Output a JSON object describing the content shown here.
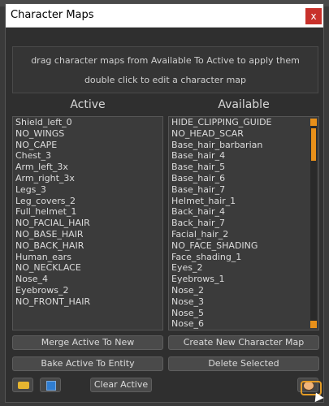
{
  "window": {
    "title": "Character Maps",
    "close_label": "x"
  },
  "info": {
    "line1": "drag character maps from Available To Active to apply them",
    "line2": "double click to edit a character map"
  },
  "active": {
    "header": "Active",
    "items": [
      "Shield_left_0",
      "NO_WINGS",
      "NO_CAPE",
      "Chest_3",
      "Arm_left_3x",
      "Arm_right_3x",
      "Legs_3",
      "Leg_covers_2",
      "Full_helmet_1",
      "NO_FACIAL_HAIR",
      "NO_BASE_HAIR",
      "NO_BACK_HAIR",
      "Human_ears",
      "NO_NECKLACE",
      "Nose_4",
      "Eyebrows_2",
      "NO_FRONT_HAIR"
    ]
  },
  "available": {
    "header": "Available",
    "items": [
      "HIDE_CLIPPING_GUIDE",
      "NO_HEAD_SCAR",
      "Base_hair_barbarian",
      "Base_hair_4",
      "Base_hair_5",
      "Base_hair_6",
      "Base_hair_7",
      "Helmet_hair_1",
      "Back_hair_4",
      "Back_hair_7",
      "Facial_hair_2",
      "NO_FACE_SHADING",
      "Face_shading_1",
      "Eyes_2",
      "Eyebrows_1",
      "Nose_2",
      "Nose_3",
      "Nose_5",
      "Nose_6"
    ]
  },
  "buttons": {
    "merge": "Merge Active To New",
    "create": "Create New Character Map",
    "bake": "Bake Active To Entity",
    "delete": "Delete Selected",
    "clear": "Clear Active"
  },
  "icons": {
    "open": "folder-icon",
    "save": "save-icon",
    "palette": "palette-icon"
  },
  "colors": {
    "accent": "#e8901a",
    "close": "#c8312b"
  }
}
